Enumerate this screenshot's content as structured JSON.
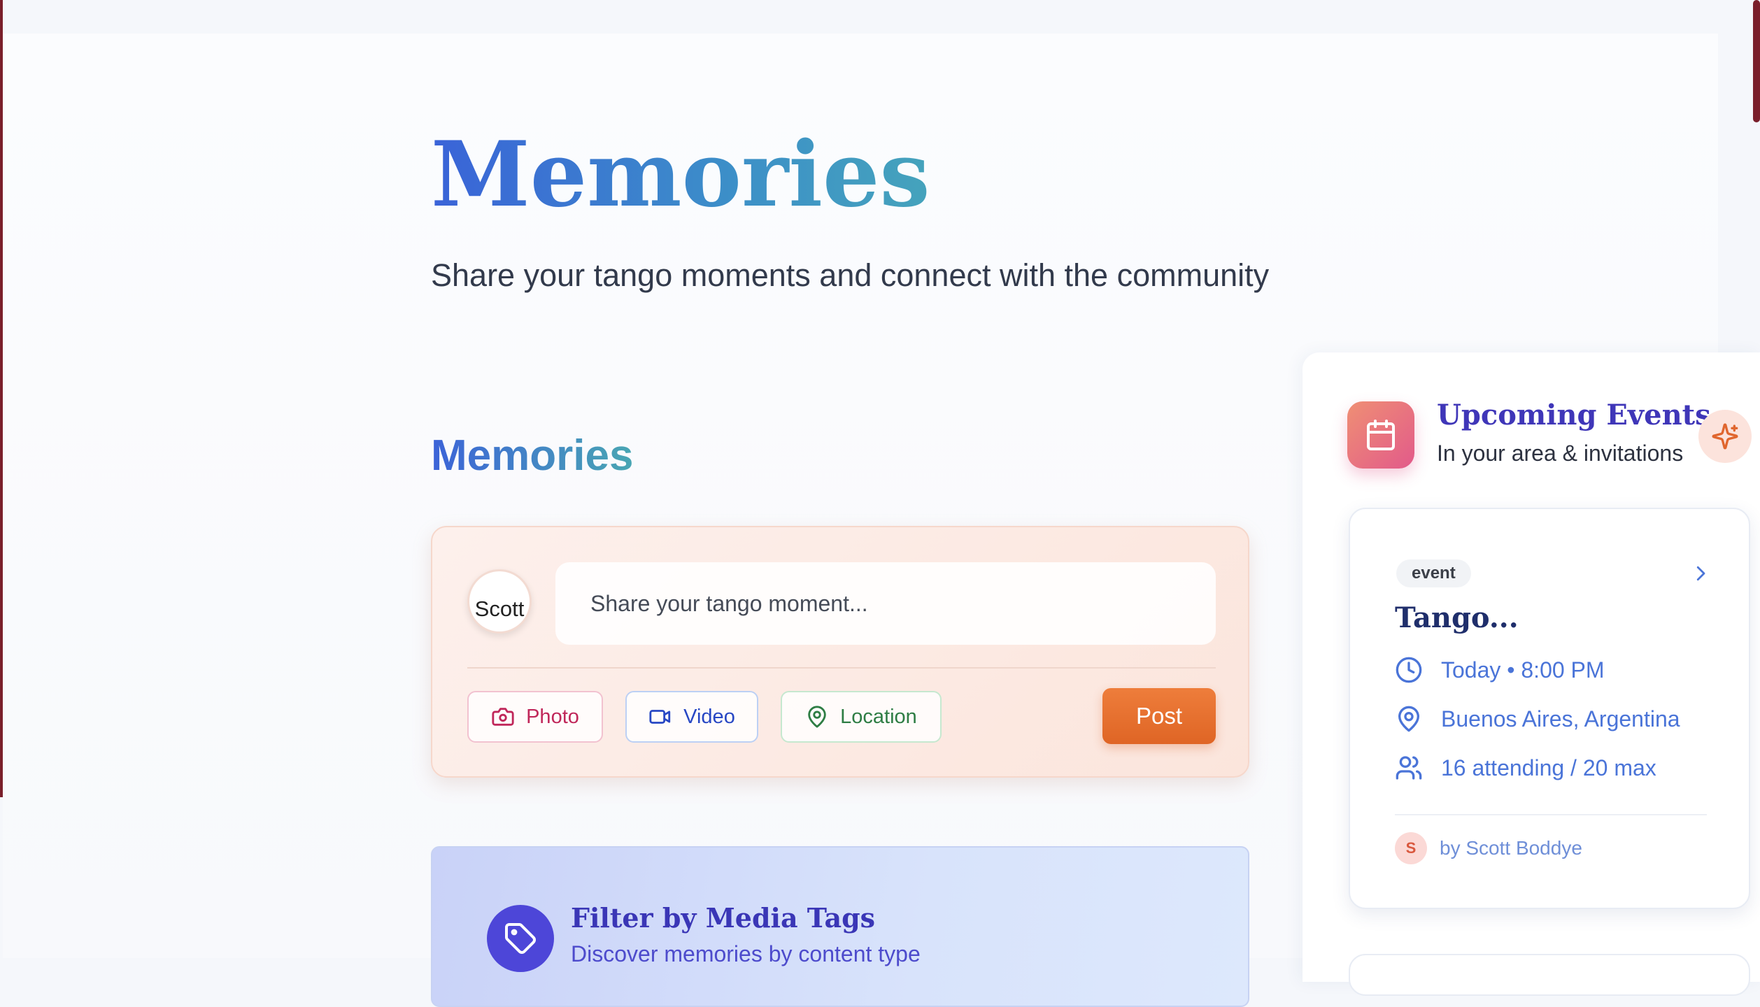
{
  "header": {
    "title": "Memories",
    "subtitle": "Share your tango moments and connect with the community"
  },
  "feed": {
    "section_title": "Memories",
    "composer": {
      "avatar_alt": "Scott",
      "placeholder": "Share your tango moment...",
      "photo_label": "Photo",
      "video_label": "Video",
      "location_label": "Location",
      "post_label": "Post"
    },
    "filter": {
      "title": "Filter by Media Tags",
      "subtitle": "Discover memories by content type"
    }
  },
  "sidebar": {
    "title": "Upcoming Events",
    "subtitle": "In your area & invitations",
    "event": {
      "badge": "event",
      "title": "Tango...",
      "time": "Today • 8:00 PM",
      "location": "Buenos Aires, Argentina",
      "attendance": "16 attending / 20 max",
      "host_initial": "S",
      "host": "by Scott Boddye"
    }
  },
  "colors": {
    "accent_blue": "#3a63d8",
    "post_orange": "#e96f2e",
    "brand_maroon": "#7a1f2b",
    "filter_purple": "#4d46d8"
  },
  "icons": [
    "camera-icon",
    "video-icon",
    "map-pin-icon",
    "tag-icon",
    "calendar-icon",
    "sparkle-icon",
    "chevron-right-icon",
    "clock-icon",
    "users-icon"
  ]
}
